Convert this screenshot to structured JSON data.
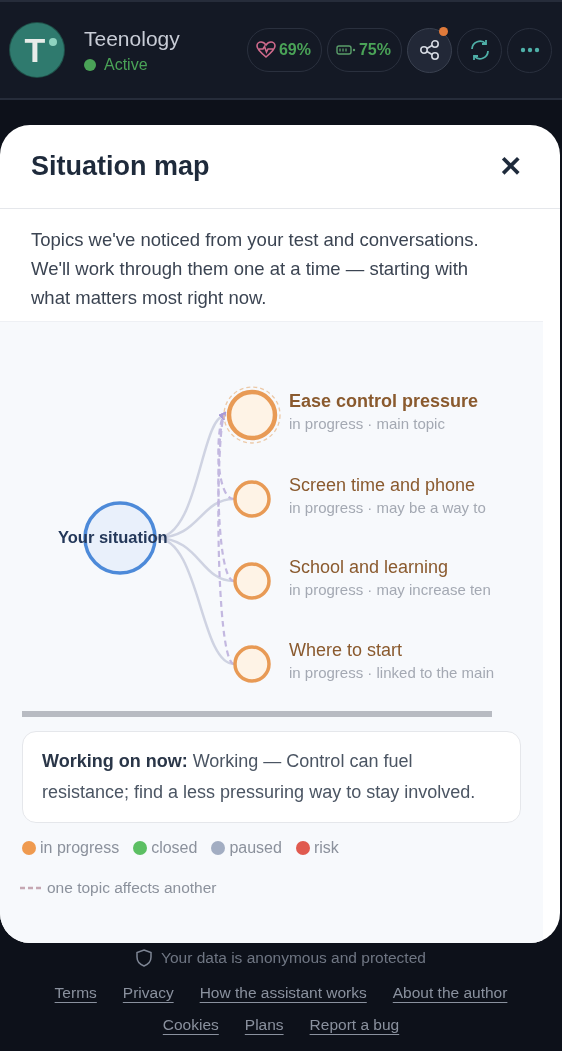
{
  "header": {
    "app_name": "Teenology",
    "avatar_letter": "T",
    "status": {
      "label": "Active",
      "online": true
    },
    "stats": [
      {
        "kind": "heart",
        "value": "69%"
      },
      {
        "kind": "battery",
        "value": "75%"
      }
    ],
    "actions": [
      {
        "kind": "share",
        "badge": true
      },
      {
        "kind": "refresh",
        "badge": false
      },
      {
        "kind": "more",
        "badge": false
      }
    ]
  },
  "modal": {
    "title": "Situation map",
    "close_symbol": "✕",
    "description": "Topics we've noticed from your test and conversations. We'll work through them one at a time — starting with what matters most right now.",
    "map": {
      "center_label": "Your situation",
      "topics": [
        {
          "title": "Ease control pressure",
          "color": "#e89a55",
          "note": "in progress · main topic",
          "main": true,
          "affects_main": false
        },
        {
          "title": "Screen time and phone",
          "color": "#e89a55",
          "note": "in progress · may be a way to",
          "main": false,
          "affects_main": true
        },
        {
          "title": "School and learning",
          "color": "#e89a55",
          "note": "in progress · may increase ten",
          "main": false,
          "affects_main": true
        },
        {
          "title": "Where to start",
          "color": "#e89a55",
          "note": "in progress · linked to the main",
          "main": false,
          "affects_main": true
        }
      ]
    },
    "working_on": {
      "label": "Working on now:",
      "text": "Working — Control can fuel resistance; find a less pressuring way to stay involved."
    },
    "legend": [
      {
        "label": "in progress",
        "color": "#ef9a4f"
      },
      {
        "label": "closed",
        "color": "#5cbf63"
      },
      {
        "label": "paused",
        "color": "#a2adc2"
      },
      {
        "label": "risk",
        "color": "#e05a4f"
      }
    ],
    "link_legend": "one topic affects another"
  },
  "footer": {
    "privacy_note": "Your data is anonymous and protected",
    "links": [
      [
        "Terms",
        "Privacy",
        "How the assistant works",
        "About the author"
      ],
      [
        "Cookies",
        "Plans",
        "Report a bug"
      ]
    ]
  }
}
